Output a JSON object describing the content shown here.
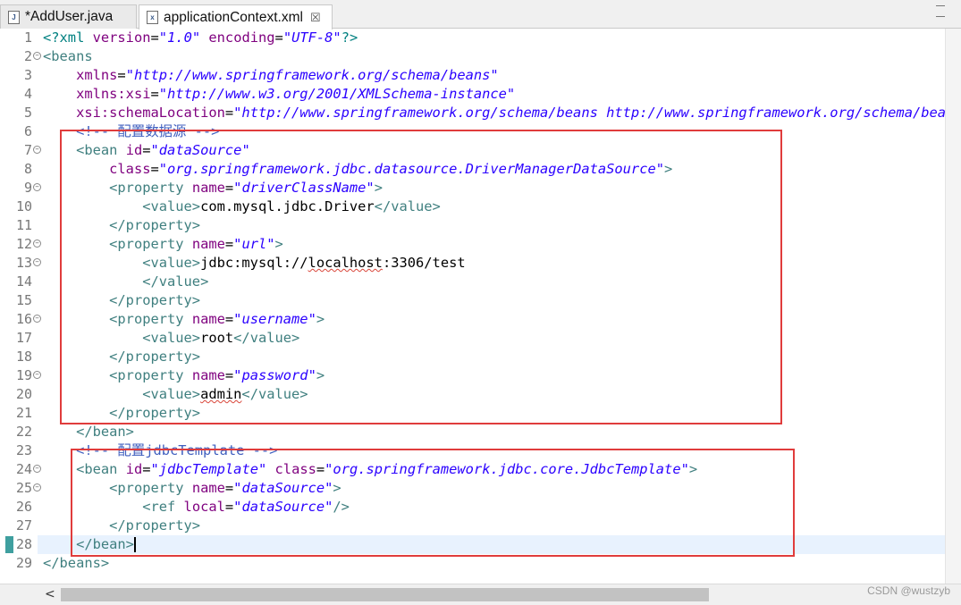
{
  "tabs": [
    {
      "label": "*AddUser.java",
      "icon": "java-file-icon",
      "icon_glyph": "J"
    },
    {
      "label": "applicationContext.xml",
      "icon": "xml-file-icon",
      "icon_glyph": "x",
      "close": "☒"
    }
  ],
  "editor": {
    "lines": [
      {
        "n": "1",
        "fold": false,
        "tokens": [
          [
            "c-pi",
            "<?xml "
          ],
          [
            "c-attr",
            "version"
          ],
          [
            "c-text",
            "="
          ],
          [
            "c-val",
            "\"1.0\""
          ],
          [
            "c-text",
            " "
          ],
          [
            "c-attr",
            "encoding"
          ],
          [
            "c-text",
            "="
          ],
          [
            "c-val",
            "\"UTF-8\""
          ],
          [
            "c-pi",
            "?>"
          ]
        ]
      },
      {
        "n": "2",
        "fold": true,
        "tokens": [
          [
            "c-tag",
            "<beans"
          ]
        ]
      },
      {
        "n": "3",
        "fold": false,
        "tokens": [
          [
            "c-text",
            "    "
          ],
          [
            "c-attr",
            "xmlns"
          ],
          [
            "c-text",
            "="
          ],
          [
            "c-val",
            "\"http://www.springframework.org/schema/beans\""
          ]
        ]
      },
      {
        "n": "4",
        "fold": false,
        "tokens": [
          [
            "c-text",
            "    "
          ],
          [
            "c-attr",
            "xmlns:xsi"
          ],
          [
            "c-text",
            "="
          ],
          [
            "c-val",
            "\"http://www.w3.org/2001/XMLSchema-instance\""
          ]
        ]
      },
      {
        "n": "5",
        "fold": false,
        "tokens": [
          [
            "c-text",
            "    "
          ],
          [
            "c-attr",
            "xsi:schemaLocation"
          ],
          [
            "c-text",
            "="
          ],
          [
            "c-val",
            "\"http://www.springframework.org/schema/beans http://www.springframework.org/schema/beans/spring-beans.xsd\">"
          ]
        ]
      },
      {
        "n": "6",
        "fold": false,
        "tokens": [
          [
            "c-text",
            "    "
          ],
          [
            "c-comment",
            "<!-- 配置数据源 -->"
          ]
        ]
      },
      {
        "n": "7",
        "fold": true,
        "tokens": [
          [
            "c-text",
            "    "
          ],
          [
            "c-tag",
            "<bean "
          ],
          [
            "c-attr",
            "id"
          ],
          [
            "c-text",
            "="
          ],
          [
            "c-val",
            "\"dataSource\""
          ]
        ]
      },
      {
        "n": "8",
        "fold": false,
        "tokens": [
          [
            "c-text",
            "        "
          ],
          [
            "c-attr",
            "class"
          ],
          [
            "c-text",
            "="
          ],
          [
            "c-val",
            "\"org.springframework.jdbc.datasource.DriverManagerDataSource\""
          ],
          [
            "c-tag",
            ">"
          ]
        ]
      },
      {
        "n": "9",
        "fold": true,
        "tokens": [
          [
            "c-text",
            "        "
          ],
          [
            "c-tag",
            "<property "
          ],
          [
            "c-attr",
            "name"
          ],
          [
            "c-text",
            "="
          ],
          [
            "c-val",
            "\"driverClassName\""
          ],
          [
            "c-tag",
            ">"
          ]
        ]
      },
      {
        "n": "10",
        "fold": false,
        "tokens": [
          [
            "c-text",
            "            "
          ],
          [
            "c-tag",
            "<value>"
          ],
          [
            "c-text",
            "com.mysql.jdbc.Driver"
          ],
          [
            "c-tag",
            "</value>"
          ]
        ]
      },
      {
        "n": "11",
        "fold": false,
        "tokens": [
          [
            "c-text",
            "        "
          ],
          [
            "c-tag",
            "</property>"
          ]
        ]
      },
      {
        "n": "12",
        "fold": true,
        "tokens": [
          [
            "c-text",
            "        "
          ],
          [
            "c-tag",
            "<property "
          ],
          [
            "c-attr",
            "name"
          ],
          [
            "c-text",
            "="
          ],
          [
            "c-val",
            "\"url\""
          ],
          [
            "c-tag",
            ">"
          ]
        ]
      },
      {
        "n": "13",
        "fold": true,
        "tokens": [
          [
            "c-text",
            "            "
          ],
          [
            "c-tag",
            "<value>"
          ],
          [
            "c-text",
            "jdbc:mysql://"
          ],
          [
            "c-text squiggle",
            "localhost"
          ],
          [
            "c-text",
            ":3306/test"
          ]
        ]
      },
      {
        "n": "14",
        "fold": false,
        "tokens": [
          [
            "c-text",
            "            "
          ],
          [
            "c-tag",
            "</value>"
          ]
        ]
      },
      {
        "n": "15",
        "fold": false,
        "tokens": [
          [
            "c-text",
            "        "
          ],
          [
            "c-tag",
            "</property>"
          ]
        ]
      },
      {
        "n": "16",
        "fold": true,
        "tokens": [
          [
            "c-text",
            "        "
          ],
          [
            "c-tag",
            "<property "
          ],
          [
            "c-attr",
            "name"
          ],
          [
            "c-text",
            "="
          ],
          [
            "c-val",
            "\"username\""
          ],
          [
            "c-tag",
            ">"
          ]
        ]
      },
      {
        "n": "17",
        "fold": false,
        "tokens": [
          [
            "c-text",
            "            "
          ],
          [
            "c-tag",
            "<value>"
          ],
          [
            "c-text",
            "root"
          ],
          [
            "c-tag",
            "</value>"
          ]
        ]
      },
      {
        "n": "18",
        "fold": false,
        "tokens": [
          [
            "c-text",
            "        "
          ],
          [
            "c-tag",
            "</property>"
          ]
        ]
      },
      {
        "n": "19",
        "fold": true,
        "tokens": [
          [
            "c-text",
            "        "
          ],
          [
            "c-tag",
            "<property "
          ],
          [
            "c-attr",
            "name"
          ],
          [
            "c-text",
            "="
          ],
          [
            "c-val",
            "\"password\""
          ],
          [
            "c-tag",
            ">"
          ]
        ]
      },
      {
        "n": "20",
        "fold": false,
        "tokens": [
          [
            "c-text",
            "            "
          ],
          [
            "c-tag",
            "<value>"
          ],
          [
            "c-text squiggle",
            "admin"
          ],
          [
            "c-tag",
            "</value>"
          ]
        ]
      },
      {
        "n": "21",
        "fold": false,
        "tokens": [
          [
            "c-text",
            "        "
          ],
          [
            "c-tag",
            "</property>"
          ]
        ]
      },
      {
        "n": "22",
        "fold": false,
        "tokens": [
          [
            "c-text",
            "    "
          ],
          [
            "c-tag",
            "</bean>"
          ]
        ]
      },
      {
        "n": "23",
        "fold": false,
        "tokens": [
          [
            "c-text",
            "    "
          ],
          [
            "c-comment",
            "<!-- 配置jdbcTemplate -->"
          ]
        ]
      },
      {
        "n": "24",
        "fold": true,
        "tokens": [
          [
            "c-text",
            "    "
          ],
          [
            "c-tag",
            "<bean "
          ],
          [
            "c-attr",
            "id"
          ],
          [
            "c-text",
            "="
          ],
          [
            "c-val",
            "\"jdbcTemplate\""
          ],
          [
            "c-text",
            " "
          ],
          [
            "c-attr",
            "class"
          ],
          [
            "c-text",
            "="
          ],
          [
            "c-val",
            "\"org.springframework.jdbc.core.JdbcTemplate\""
          ],
          [
            "c-tag",
            ">"
          ]
        ]
      },
      {
        "n": "25",
        "fold": true,
        "tokens": [
          [
            "c-text",
            "        "
          ],
          [
            "c-tag",
            "<property "
          ],
          [
            "c-attr",
            "name"
          ],
          [
            "c-text",
            "="
          ],
          [
            "c-val",
            "\"dataSource\""
          ],
          [
            "c-tag",
            ">"
          ]
        ]
      },
      {
        "n": "26",
        "fold": false,
        "tokens": [
          [
            "c-text",
            "            "
          ],
          [
            "c-tag",
            "<ref "
          ],
          [
            "c-attr",
            "local"
          ],
          [
            "c-text",
            "="
          ],
          [
            "c-val",
            "\"dataSource\""
          ],
          [
            "c-tag",
            "/>"
          ]
        ]
      },
      {
        "n": "27",
        "fold": false,
        "tokens": [
          [
            "c-text",
            "        "
          ],
          [
            "c-tag",
            "</property>"
          ]
        ]
      },
      {
        "n": "28",
        "fold": false,
        "caret": true,
        "tokens": [
          [
            "c-text",
            "    "
          ],
          [
            "c-tag",
            "</bean>"
          ]
        ]
      },
      {
        "n": "29",
        "fold": false,
        "tokens": [
          [
            "c-tag",
            "</beans>"
          ]
        ]
      }
    ]
  },
  "watermark": "CSDN @wustzyb",
  "colors": {
    "highlight": "#e03c3c",
    "tag": "#3f7f7f",
    "attr": "#7f007f",
    "value": "#2a00ff"
  }
}
